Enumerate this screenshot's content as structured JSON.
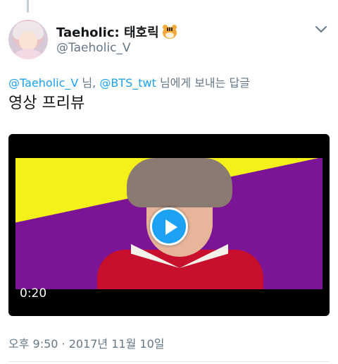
{
  "author": {
    "display_name": "Taeholic: 태호릭",
    "emoji": "tiger-face-emoji",
    "handle": "@Taeholic_V"
  },
  "reply": {
    "mention_1": "@Taeholic_V",
    "sep_1": " 님, ",
    "mention_2": "@BTS_twt",
    "suffix": " 님에게 보내는 답글"
  },
  "tweet": {
    "text": "영상 프리뷰"
  },
  "video": {
    "duration": "0:20",
    "play_icon": "play-icon"
  },
  "meta": {
    "timestamp": "오후 9:50 · 2017년 11월 10일"
  },
  "colors": {
    "link": "#1da1f2",
    "secondary_text": "#657786",
    "video_yellow": "#f4f01a",
    "video_purple": "#7b1596"
  }
}
